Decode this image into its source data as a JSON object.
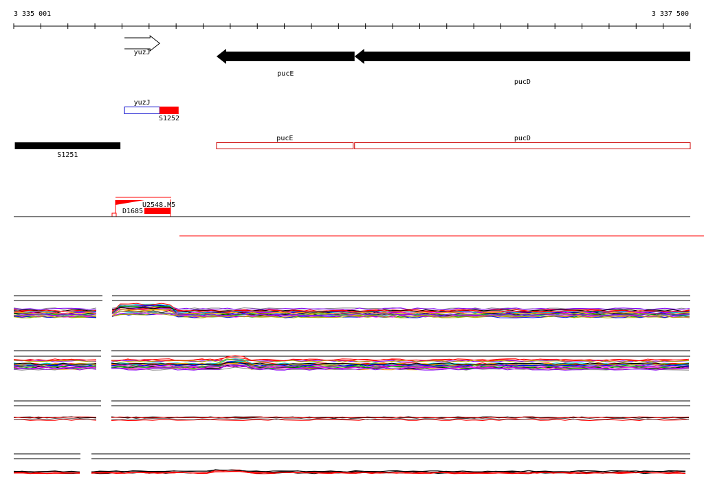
{
  "ruler": {
    "start_label": "3 335 001",
    "end_label": "3 337 500",
    "start": 3335001,
    "end": 3337500,
    "tick_count": 26
  },
  "genes": [
    {
      "name": "yuzJ",
      "start": 3335410,
      "end": 3335540,
      "strand": "+"
    },
    {
      "name": "pucE",
      "start": 3335750,
      "end": 3336260,
      "strand": "-"
    },
    {
      "name": "pucD",
      "start": 3336260,
      "end": 3337500,
      "strand": "-"
    }
  ],
  "transcripts": [
    {
      "label": "yuzJ",
      "start": 3335410,
      "end": 3335540,
      "color": "#0000cc",
      "style": "outline"
    },
    {
      "label": "S1252",
      "start": 3335540,
      "end": 3335610,
      "color": "#ff0000",
      "style": "filled"
    },
    {
      "label": "S1251",
      "start": 3335005,
      "end": 3335395,
      "color": "#000000",
      "style": "filled"
    },
    {
      "label": "pucE",
      "start": 3335750,
      "end": 3336255,
      "color": "#cc0000",
      "style": "outline"
    },
    {
      "label": "pucD",
      "start": 3336260,
      "end": 3337500,
      "color": "#cc0000",
      "style": "outline"
    }
  ],
  "regulation": {
    "labels": [
      "U2548.M5",
      "D1685"
    ],
    "colors": {
      "up": "#ff0000",
      "down": "#000000"
    }
  },
  "profiles": {
    "colors": [
      "#000000",
      "#ff0000",
      "#00aa00",
      "#0000ff",
      "#ff00ff",
      "#00cccc",
      "#ffaa00",
      "#888888",
      "#8800ff",
      "#aaaa00"
    ]
  }
}
